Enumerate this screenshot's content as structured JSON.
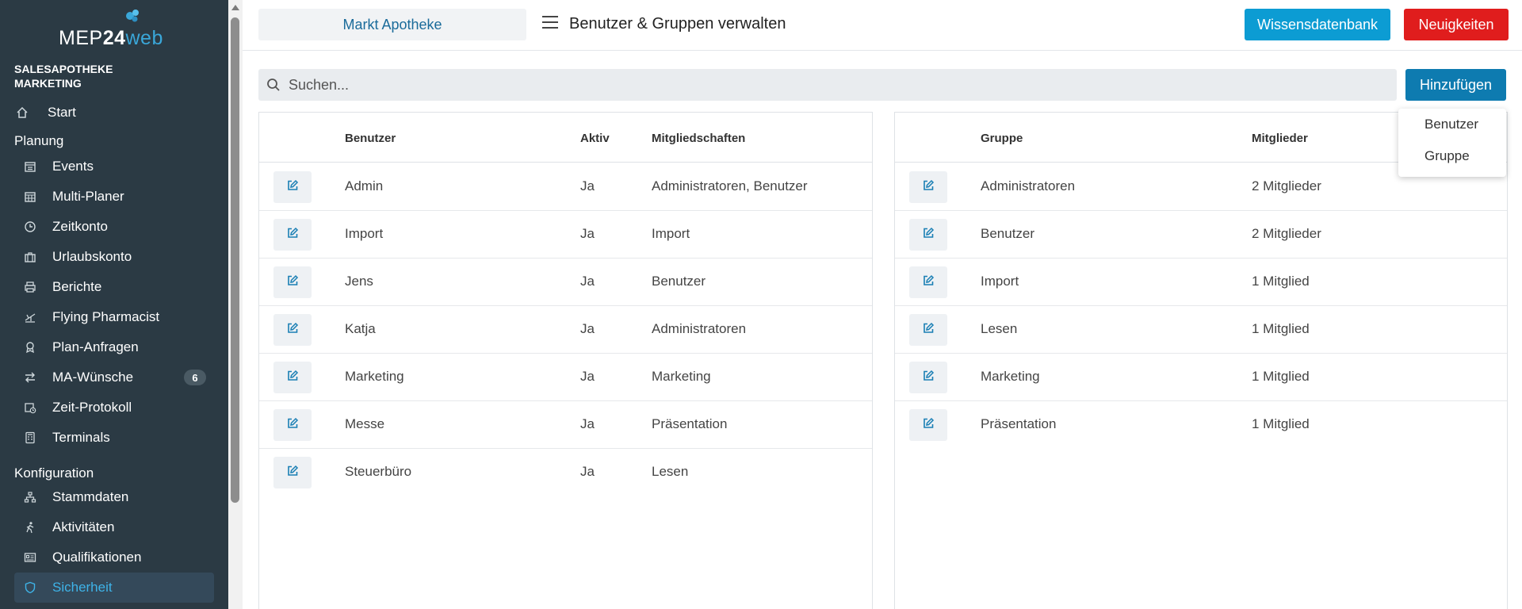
{
  "app": {
    "logo_text_a": "MEP",
    "logo_text_b": "24",
    "logo_text_c": "web",
    "company": "SALESAPOTHEKE MARKETING"
  },
  "sidebar": {
    "start": {
      "label": "Start",
      "icon": "home-icon"
    },
    "sections": [
      {
        "title": "Planung",
        "items": [
          {
            "label": "Events",
            "icon": "calendar-icon"
          },
          {
            "label": "Multi-Planer",
            "icon": "calendar-grid-icon"
          },
          {
            "label": "Zeitkonto",
            "icon": "clock-icon"
          },
          {
            "label": "Urlaubskonto",
            "icon": "suitcase-icon"
          },
          {
            "label": "Berichte",
            "icon": "printer-icon"
          },
          {
            "label": "Flying Pharmacist",
            "icon": "plane-icon"
          },
          {
            "label": "Plan-Anfragen",
            "icon": "award-icon"
          },
          {
            "label": "MA-Wünsche",
            "icon": "swap-arrows-icon",
            "badge": "6"
          },
          {
            "label": "Zeit-Protokoll",
            "icon": "calendar-clock-icon"
          },
          {
            "label": "Terminals",
            "icon": "terminal-icon"
          }
        ]
      },
      {
        "title": "Konfiguration",
        "items": [
          {
            "label": "Stammdaten",
            "icon": "hierarchy-icon"
          },
          {
            "label": "Aktivitäten",
            "icon": "walking-icon"
          },
          {
            "label": "Qualifikationen",
            "icon": "id-card-icon"
          },
          {
            "label": "Sicherheit",
            "icon": "shield-icon",
            "active": true
          }
        ]
      }
    ]
  },
  "header": {
    "pharmacy": "Markt Apotheke",
    "title": "Benutzer & Gruppen verwalten",
    "btn_wissen": "Wissensdatenbank",
    "btn_neu": "Neuigkeiten"
  },
  "search": {
    "placeholder": "Suchen...",
    "value": ""
  },
  "add": {
    "label": "Hinzufügen",
    "options": [
      "Benutzer",
      "Gruppe"
    ]
  },
  "users_table": {
    "headers": [
      "Benutzer",
      "Aktiv",
      "Mitgliedschaften"
    ],
    "rows": [
      [
        "Admin",
        "Ja",
        "Administratoren, Benutzer"
      ],
      [
        "Import",
        "Ja",
        "Import"
      ],
      [
        "Jens",
        "Ja",
        "Benutzer"
      ],
      [
        "Katja",
        "Ja",
        "Administratoren"
      ],
      [
        "Marketing",
        "Ja",
        "Marketing"
      ],
      [
        "Messe",
        "Ja",
        "Präsentation"
      ],
      [
        "Steuerbüro",
        "Ja",
        "Lesen"
      ]
    ]
  },
  "groups_table": {
    "headers": [
      "Gruppe",
      "Mitglieder"
    ],
    "rows": [
      [
        "Administratoren",
        "2 Mitglieder"
      ],
      [
        "Benutzer",
        "2 Mitglieder"
      ],
      [
        "Import",
        "1 Mitglied"
      ],
      [
        "Lesen",
        "1 Mitglied"
      ],
      [
        "Marketing",
        "1 Mitglied"
      ],
      [
        "Präsentation",
        "1 Mitglied"
      ]
    ]
  },
  "colors": {
    "sidebar_bg": "#2b3a44",
    "accent": "#0c9cd3",
    "danger": "#e01d1d",
    "primary": "#0e7bb0",
    "active_text": "#3eb3e8"
  }
}
